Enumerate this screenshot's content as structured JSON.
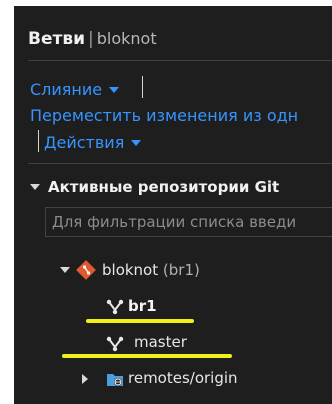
{
  "header": {
    "title": "Ветви",
    "separator": "|",
    "repo": "bloknot"
  },
  "actions": {
    "merge_label": "Слияние",
    "move_changes_label": "Переместить изменения из одн",
    "actions_label": "Действия"
  },
  "repositories": {
    "section_title": "Активные репозитории Git",
    "filter_placeholder": "Для фильтрации списка введи",
    "repo": {
      "name": "bloknot",
      "current_branch": "(br1)",
      "branches": [
        {
          "label": "br1",
          "is_current": true
        },
        {
          "label": "master",
          "is_current": false
        }
      ],
      "remote": {
        "label": "remotes/origin",
        "expanded": false
      }
    }
  },
  "colors": {
    "background": "#1e1e1e",
    "link": "#3794ff",
    "highlight_underline": "#f2ef1b",
    "repo_icon": "#e05a2e"
  },
  "icons": {
    "repo": "git-repo-diamond-icon",
    "branch": "git-branch-icon",
    "remote": "remote-folder-icon"
  }
}
